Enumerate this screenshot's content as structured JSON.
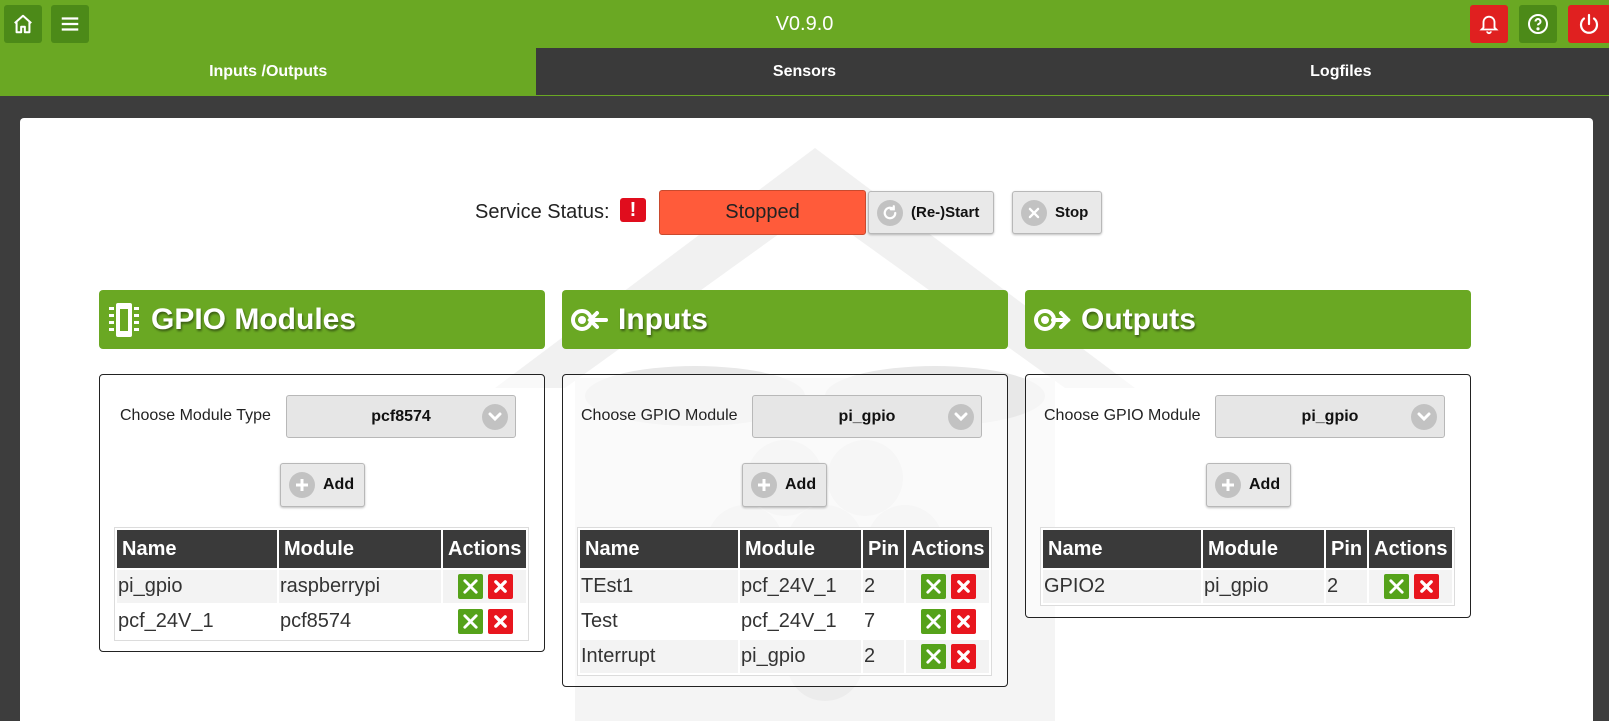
{
  "header": {
    "version": "V0.9.0"
  },
  "tabs": [
    {
      "label": "Inputs /Outputs",
      "active": true
    },
    {
      "label": "Sensors",
      "active": false
    },
    {
      "label": "Logfiles",
      "active": false
    }
  ],
  "service": {
    "label": "Service Status:",
    "alert": "!",
    "status": "Stopped",
    "restart_label": "(Re-)Start",
    "stop_label": "Stop"
  },
  "gpio_modules": {
    "title": "GPIO Modules",
    "choose_label": "Choose Module Type",
    "selected": "pcf8574",
    "add_label": "Add",
    "columns": [
      "Name",
      "Module",
      "Actions"
    ],
    "rows": [
      {
        "name": "pi_gpio",
        "module": "raspberrypi"
      },
      {
        "name": "pcf_24V_1",
        "module": "pcf8574"
      }
    ]
  },
  "inputs": {
    "title": "Inputs",
    "choose_label": "Choose GPIO Module",
    "selected": "pi_gpio",
    "add_label": "Add",
    "columns": [
      "Name",
      "Module",
      "Pin",
      "Actions"
    ],
    "rows": [
      {
        "name": "TEst1",
        "module": "pcf_24V_1",
        "pin": "2"
      },
      {
        "name": "Test",
        "module": "pcf_24V_1",
        "pin": "7"
      },
      {
        "name": "Interrupt",
        "module": "pi_gpio",
        "pin": "2"
      }
    ]
  },
  "outputs": {
    "title": "Outputs",
    "choose_label": "Choose GPIO Module",
    "selected": "pi_gpio",
    "add_label": "Add",
    "columns": [
      "Name",
      "Module",
      "Pin",
      "Actions"
    ],
    "rows": [
      {
        "name": "GPIO2",
        "module": "pi_gpio",
        "pin": "2"
      }
    ]
  },
  "colors": {
    "brand_green": "#6aa823",
    "dark_bar": "#3a3a3a",
    "alert_red": "#e02020",
    "status_stopped": "#ff5b3a"
  },
  "icons": {
    "home": "home-icon",
    "menu": "menu-icon",
    "bell": "bell-icon",
    "help": "help-icon",
    "power": "power-icon"
  }
}
